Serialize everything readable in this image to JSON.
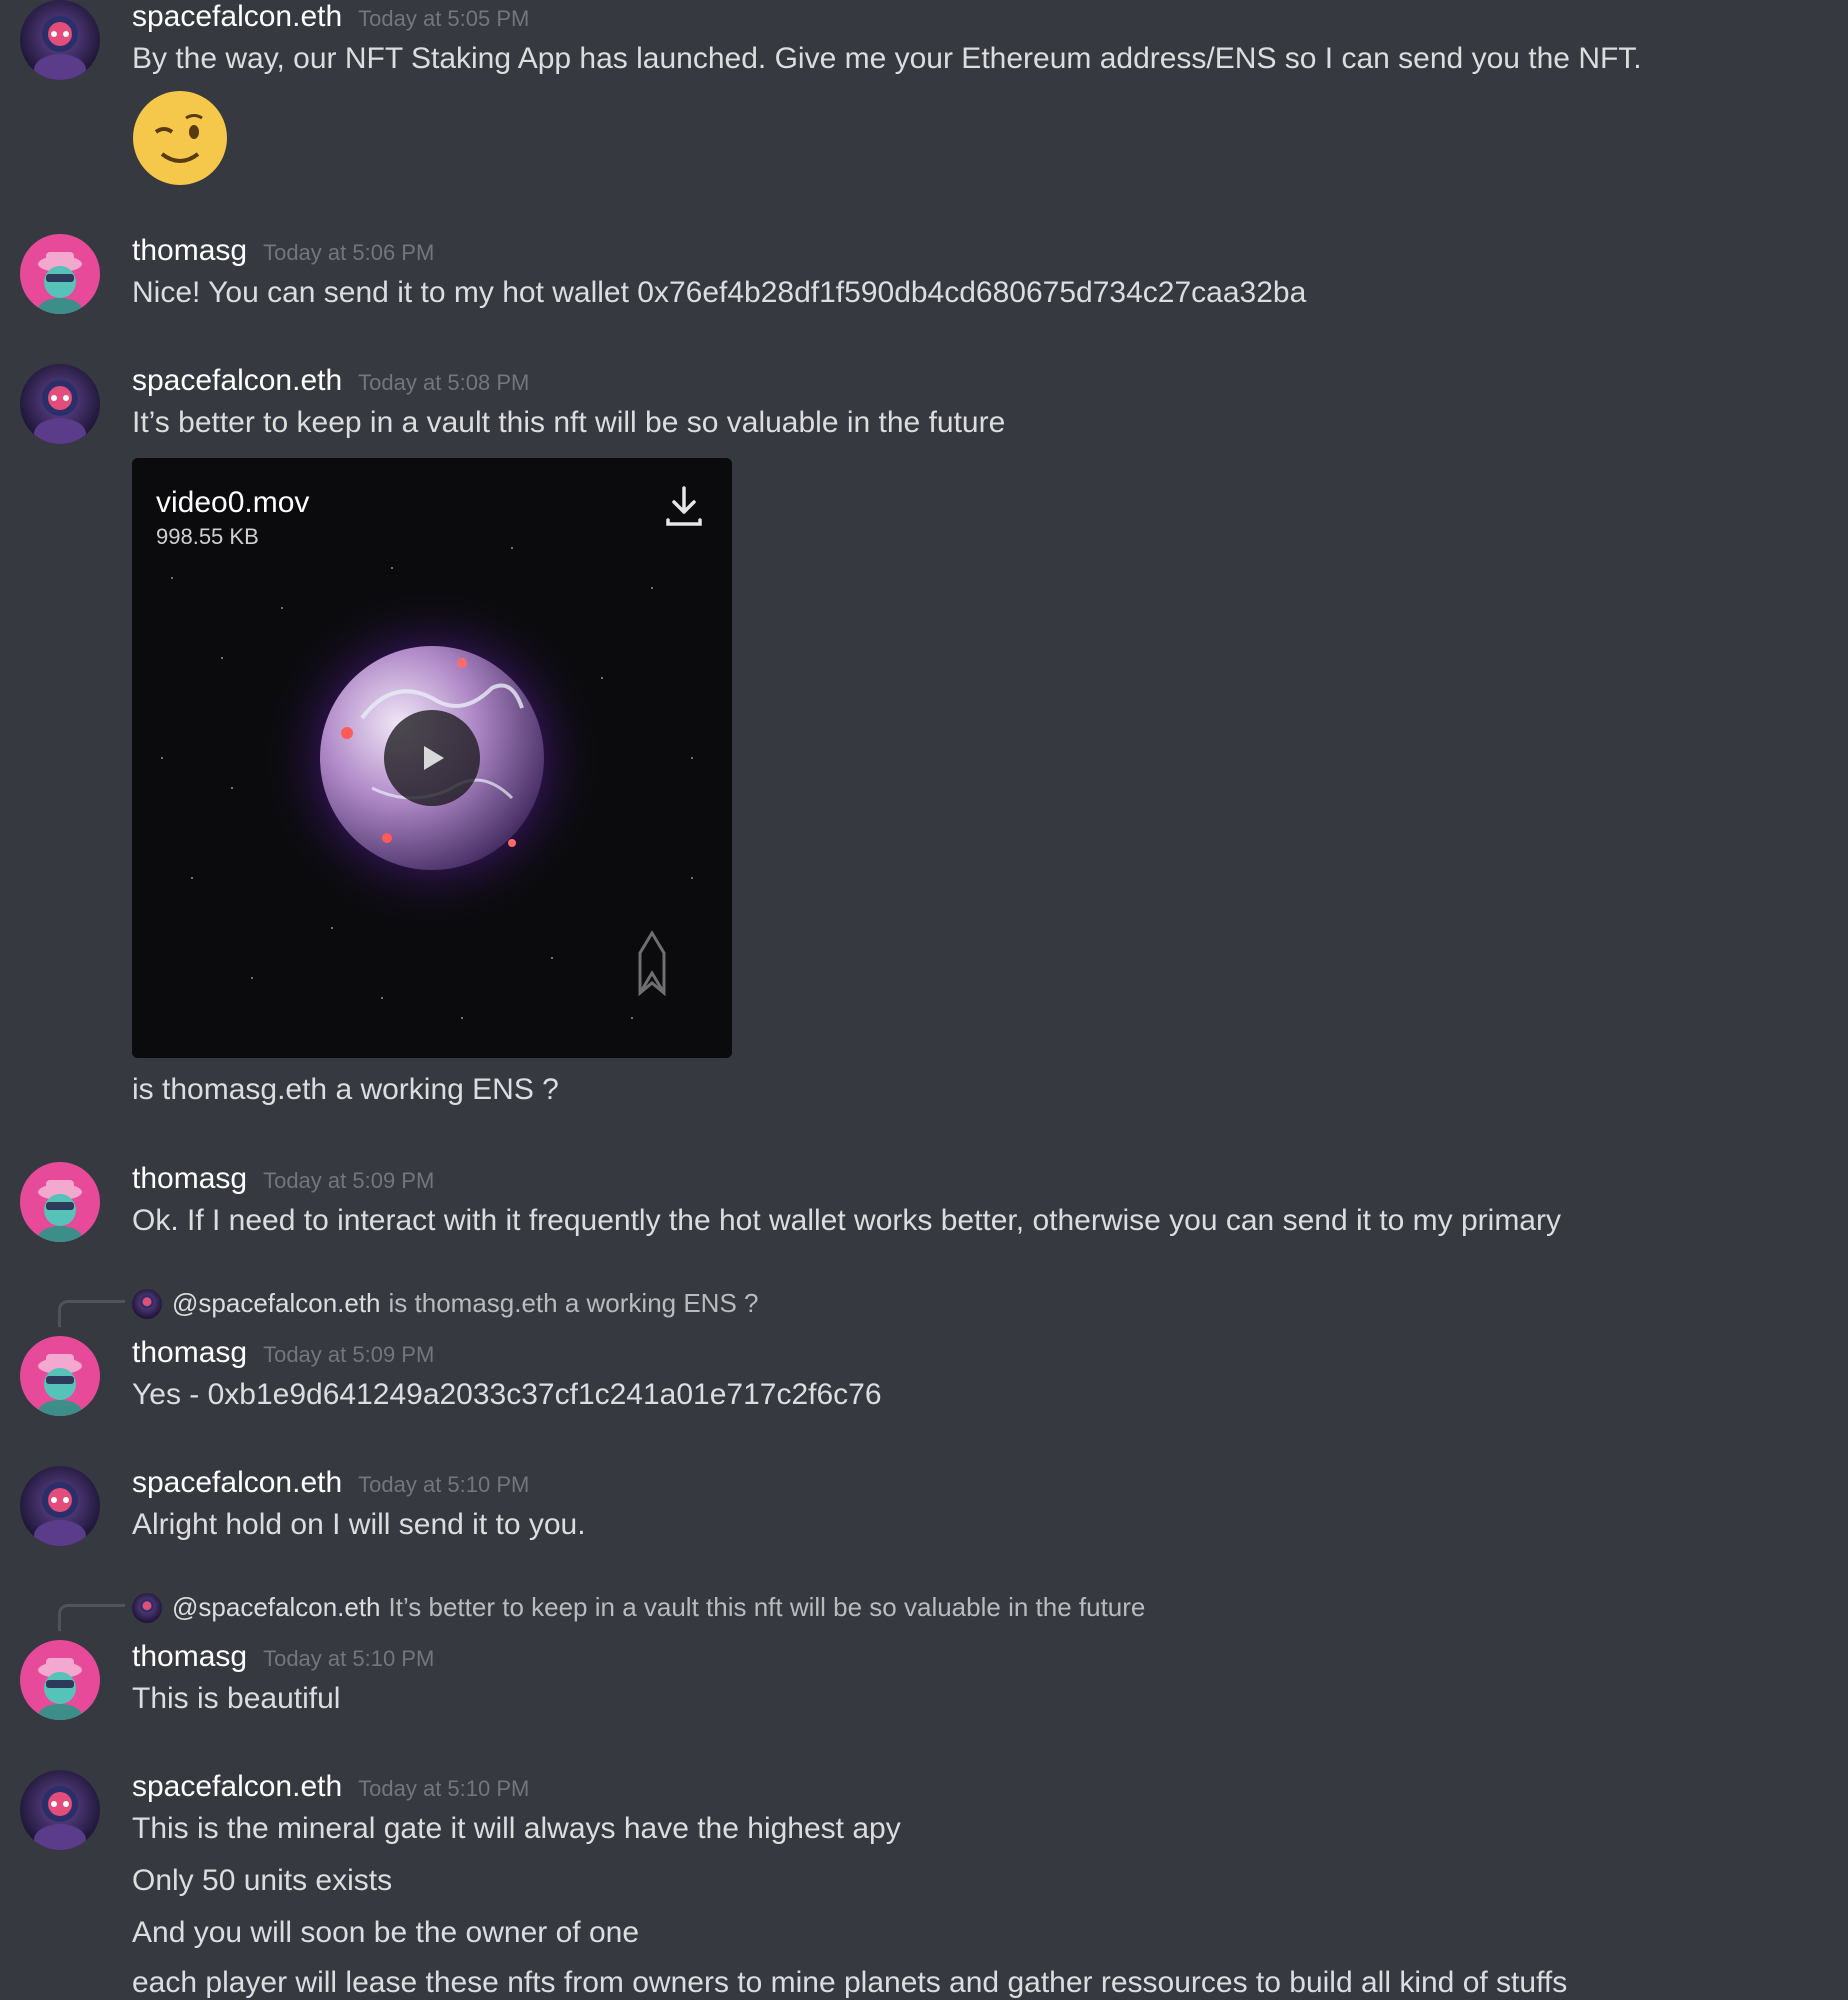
{
  "messages": [
    {
      "author": "spacefalcon.eth",
      "time": "Today at 5:05 PM",
      "lines": [
        "By the way, our NFT Staking App has launched. Give me your Ethereum address/ENS so I can send you the NFT."
      ],
      "emoji": "winking-face"
    },
    {
      "author": "thomasg",
      "time": "Today at 5:06 PM",
      "lines": [
        "Nice! You can send it to my hot wallet 0x76ef4b28df1f590db4cd680675d734c27caa32ba"
      ]
    },
    {
      "author": "spacefalcon.eth",
      "time": "Today at 5:08 PM",
      "lines": [
        "It’s better to keep in a vault this nft will be so valuable in the future"
      ],
      "attachment": {
        "filename": "video0.mov",
        "size": "998.55 KB"
      },
      "after_lines": [
        "is thomasg.eth a working ENS ?"
      ]
    },
    {
      "author": "thomasg",
      "time": "Today at 5:09 PM",
      "lines": [
        "Ok. If I need to interact with it frequently the hot wallet works better, otherwise you can send it to my primary"
      ]
    },
    {
      "reply_to": {
        "mention": "@spacefalcon.eth",
        "text": "is thomasg.eth a working ENS ?"
      },
      "author": "thomasg",
      "time": "Today at 5:09 PM",
      "lines": [
        "Yes - 0xb1e9d641249a2033c37cf1c241a01e717c2f6c76"
      ]
    },
    {
      "author": "spacefalcon.eth",
      "time": "Today at 5:10 PM",
      "lines": [
        "Alright hold on I will send it to you."
      ]
    },
    {
      "reply_to": {
        "mention": "@spacefalcon.eth",
        "text": "It’s better to keep in a vault this nft will be so valuable in the future"
      },
      "author": "thomasg",
      "time": "Today at 5:10 PM",
      "lines": [
        "This is beautiful"
      ]
    },
    {
      "author": "spacefalcon.eth",
      "time": "Today at 5:10 PM",
      "lines": [
        "This is the mineral gate it will always have the highest apy",
        "Only 50 units exists",
        "And you will soon be the owner of one",
        "each player will lease these nfts from owners to mine planets and gather ressources to build all kind of stuffs"
      ]
    }
  ],
  "colors": {
    "background": "#36393f",
    "username": "#ffffff",
    "timestamp": "#72767d",
    "text": "#dcddde",
    "reply_text": "#b9bbbe"
  }
}
